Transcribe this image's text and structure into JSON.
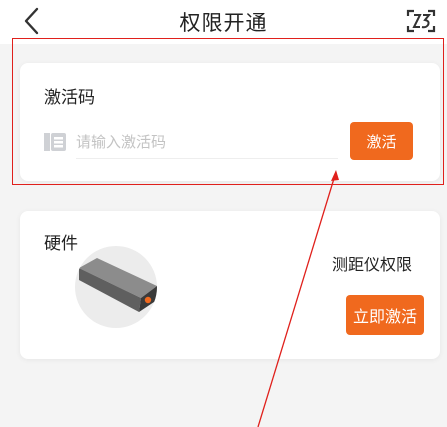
{
  "header": {
    "title": "权限开通",
    "back_icon": "chevron-left-icon",
    "scan_icon": "scan-code-icon"
  },
  "activation": {
    "label": "激活码",
    "input_placeholder": "请输入激活码",
    "input_value": "",
    "code_icon": "ticket-code-icon",
    "button_label": "激活"
  },
  "hardware": {
    "label": "硬件",
    "device_name": "测距仪权限",
    "button_label": "立即激活"
  },
  "colors": {
    "accent": "#f0691e",
    "annotation": "#e0201c",
    "background": "#f4f4f4"
  }
}
